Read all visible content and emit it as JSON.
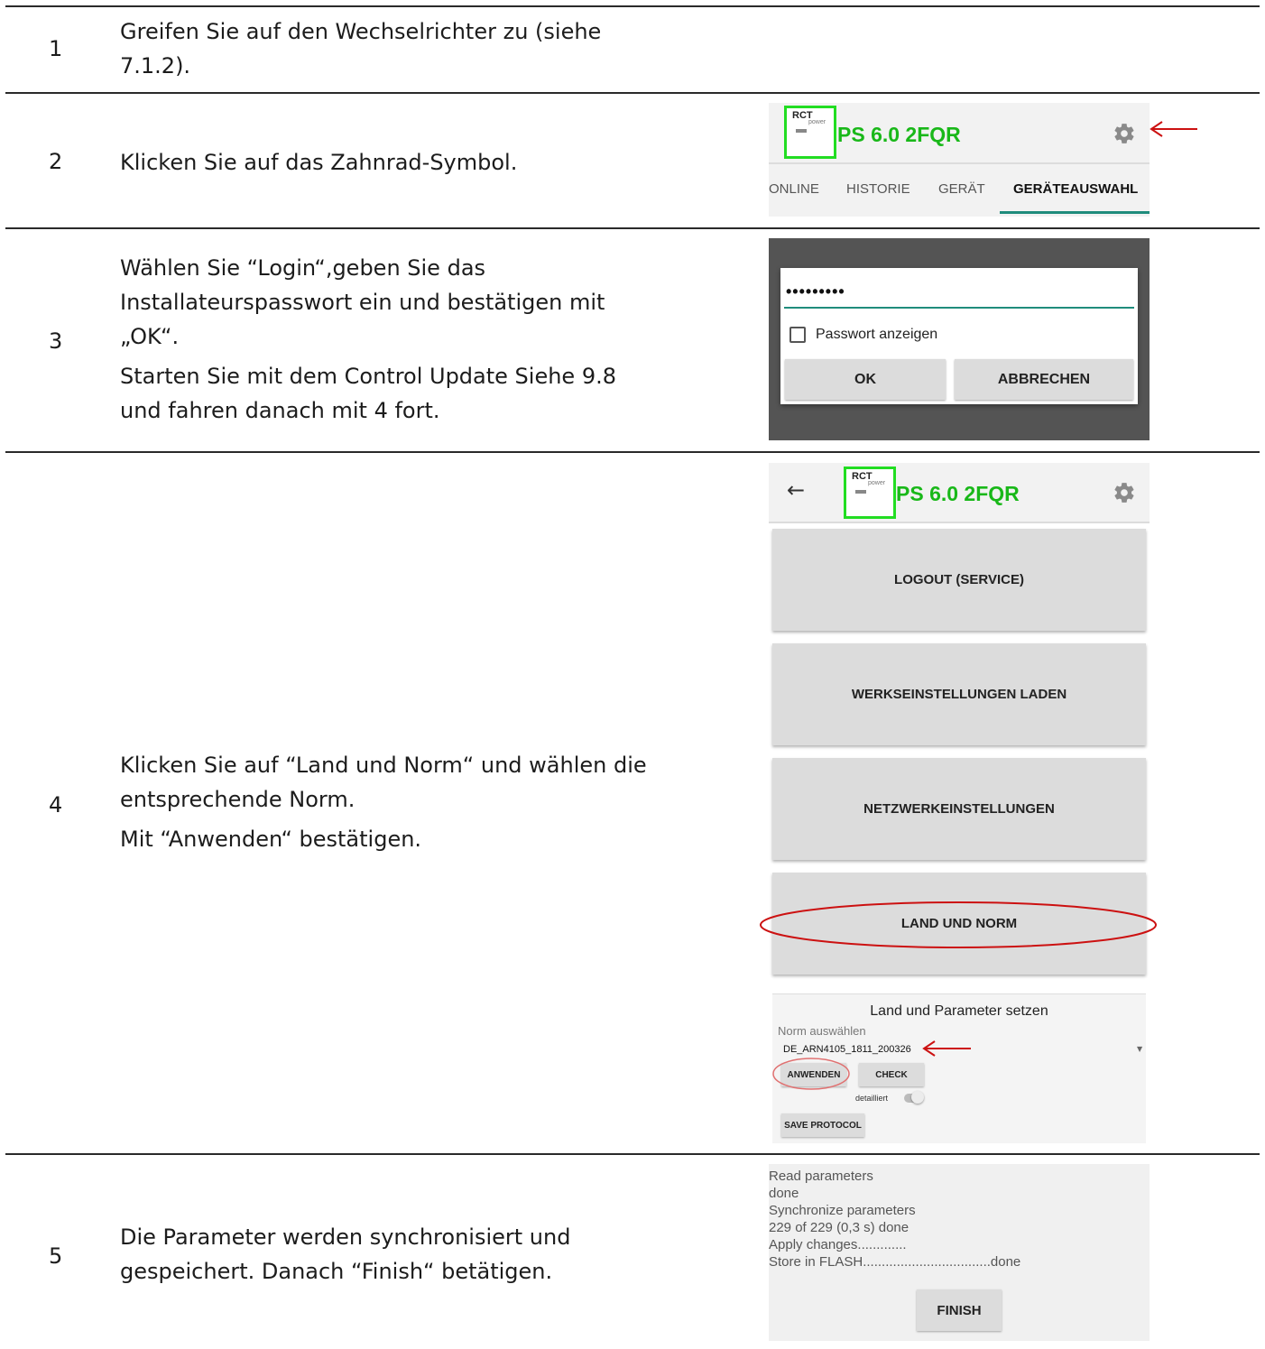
{
  "steps": [
    {
      "number": "1",
      "lines": [
        "Greifen Sie auf den Wechselrichter zu (siehe",
        "7.1.2)."
      ]
    },
    {
      "number": "2",
      "lines": [
        "Klicken Sie auf das Zahnrad-Symbol."
      ]
    },
    {
      "number": "3",
      "lines": [
        "Wählen Sie “Login“,geben Sie das",
        "Installateurspasswort ein und bestätigen mit",
        "„OK“.",
        "Starten Sie mit dem Control Update Siehe 9.8",
        "und fahren danach mit 4 fort."
      ]
    },
    {
      "number": "4",
      "lines": [
        "Klicken Sie auf “Land und Norm“ und wählen die",
        "entsprechende Norm.",
        "Mit “Anwenden“ bestätigen."
      ]
    },
    {
      "number": "5",
      "lines": [
        "Die Parameter werden synchronisiert und",
        "gespeichert. Danach “Finish“ betätigen."
      ]
    }
  ],
  "app": {
    "device_name": "PS 6.0 2FQR",
    "logo_text": "RCT",
    "logo_subtext": "power",
    "brand_green": "#19b819",
    "accent_teal": "#1f8c7c",
    "annotation_red": "#cc1111"
  },
  "tabs": {
    "items": [
      "ONLINE",
      "HISTORIE",
      "GERÄT",
      "GERÄTEAUSWAHL"
    ],
    "active": "GERÄTEAUSWAHL"
  },
  "login_dialog": {
    "password_value": "•••••••••",
    "show_password_label": "Passwort anzeigen",
    "ok_label": "OK",
    "cancel_label": "ABBRECHEN"
  },
  "settings_menu": {
    "buttons": [
      "LOGOUT (SERVICE)",
      "WERKSEINSTELLUNGEN LADEN",
      "NETZWERKEINSTELLUNGEN",
      "LAND UND NORM"
    ]
  },
  "norm_panel": {
    "title": "Land und Parameter setzen",
    "select_label": "Norm auswählen",
    "selected_norm": "DE_ARN4105_1811_200326",
    "apply_label": "ANWENDEN",
    "check_label": "CHECK",
    "detailed_label": "detailliert",
    "save_protocol_label": "SAVE PROTOCOL"
  },
  "sync_log": {
    "lines": [
      "Read parameters",
      "done",
      "Synchronize parameters",
      "229 of 229 (0,3 s) done",
      "Apply changes.............",
      "Store in FLASH..................................done"
    ],
    "finish_label": "FINISH"
  }
}
